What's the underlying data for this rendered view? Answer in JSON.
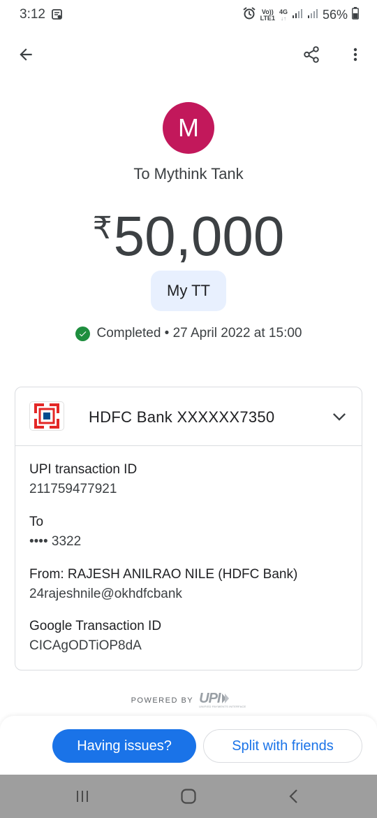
{
  "status_bar": {
    "time": "3:12",
    "battery": "56%",
    "icons": [
      "message-icon",
      "alarm-icon",
      "volte-icon",
      "4g-icon",
      "signal-icon",
      "signal-icon",
      "battery-icon"
    ],
    "volte_label": "Vo))\nLTE1",
    "network_label": "4G"
  },
  "app_bar": {
    "back_icon": "arrow-left-icon",
    "share_icon": "share-icon",
    "more_icon": "more-vert-icon"
  },
  "payee": {
    "avatar_initial": "M",
    "avatar_color": "#c2185b",
    "name": "To Mythink Tank",
    "currency_symbol": "₹",
    "amount": "50,000",
    "note": "My TT"
  },
  "transaction_status": {
    "text": "Completed • 27 April 2022 at 15:00",
    "color": "#1e8e3e"
  },
  "card": {
    "bank_name": "HDFC Bank XXXXXX7350",
    "details": [
      {
        "label": "UPI transaction ID",
        "value": "211759477921"
      },
      {
        "label": "To",
        "value": "•••• 3322"
      },
      {
        "label": "From: RAJESH ANILRAO NILE (HDFC Bank)",
        "value": "24rajeshnile@okhdfcbank"
      },
      {
        "label": "Google Transaction ID",
        "value": "CICAgODTiOP8dA"
      }
    ]
  },
  "powered_by": {
    "text": "POWERED BY",
    "logo": "UPI",
    "tagline": "UNIFIED PAYMENTS INTERFACE"
  },
  "actions": {
    "primary": "Having issues?",
    "secondary": "Split with friends",
    "accent": "#1a73e8"
  },
  "nav_bar": {
    "icons": [
      "recents-icon",
      "home-icon",
      "back-nav-icon"
    ]
  }
}
